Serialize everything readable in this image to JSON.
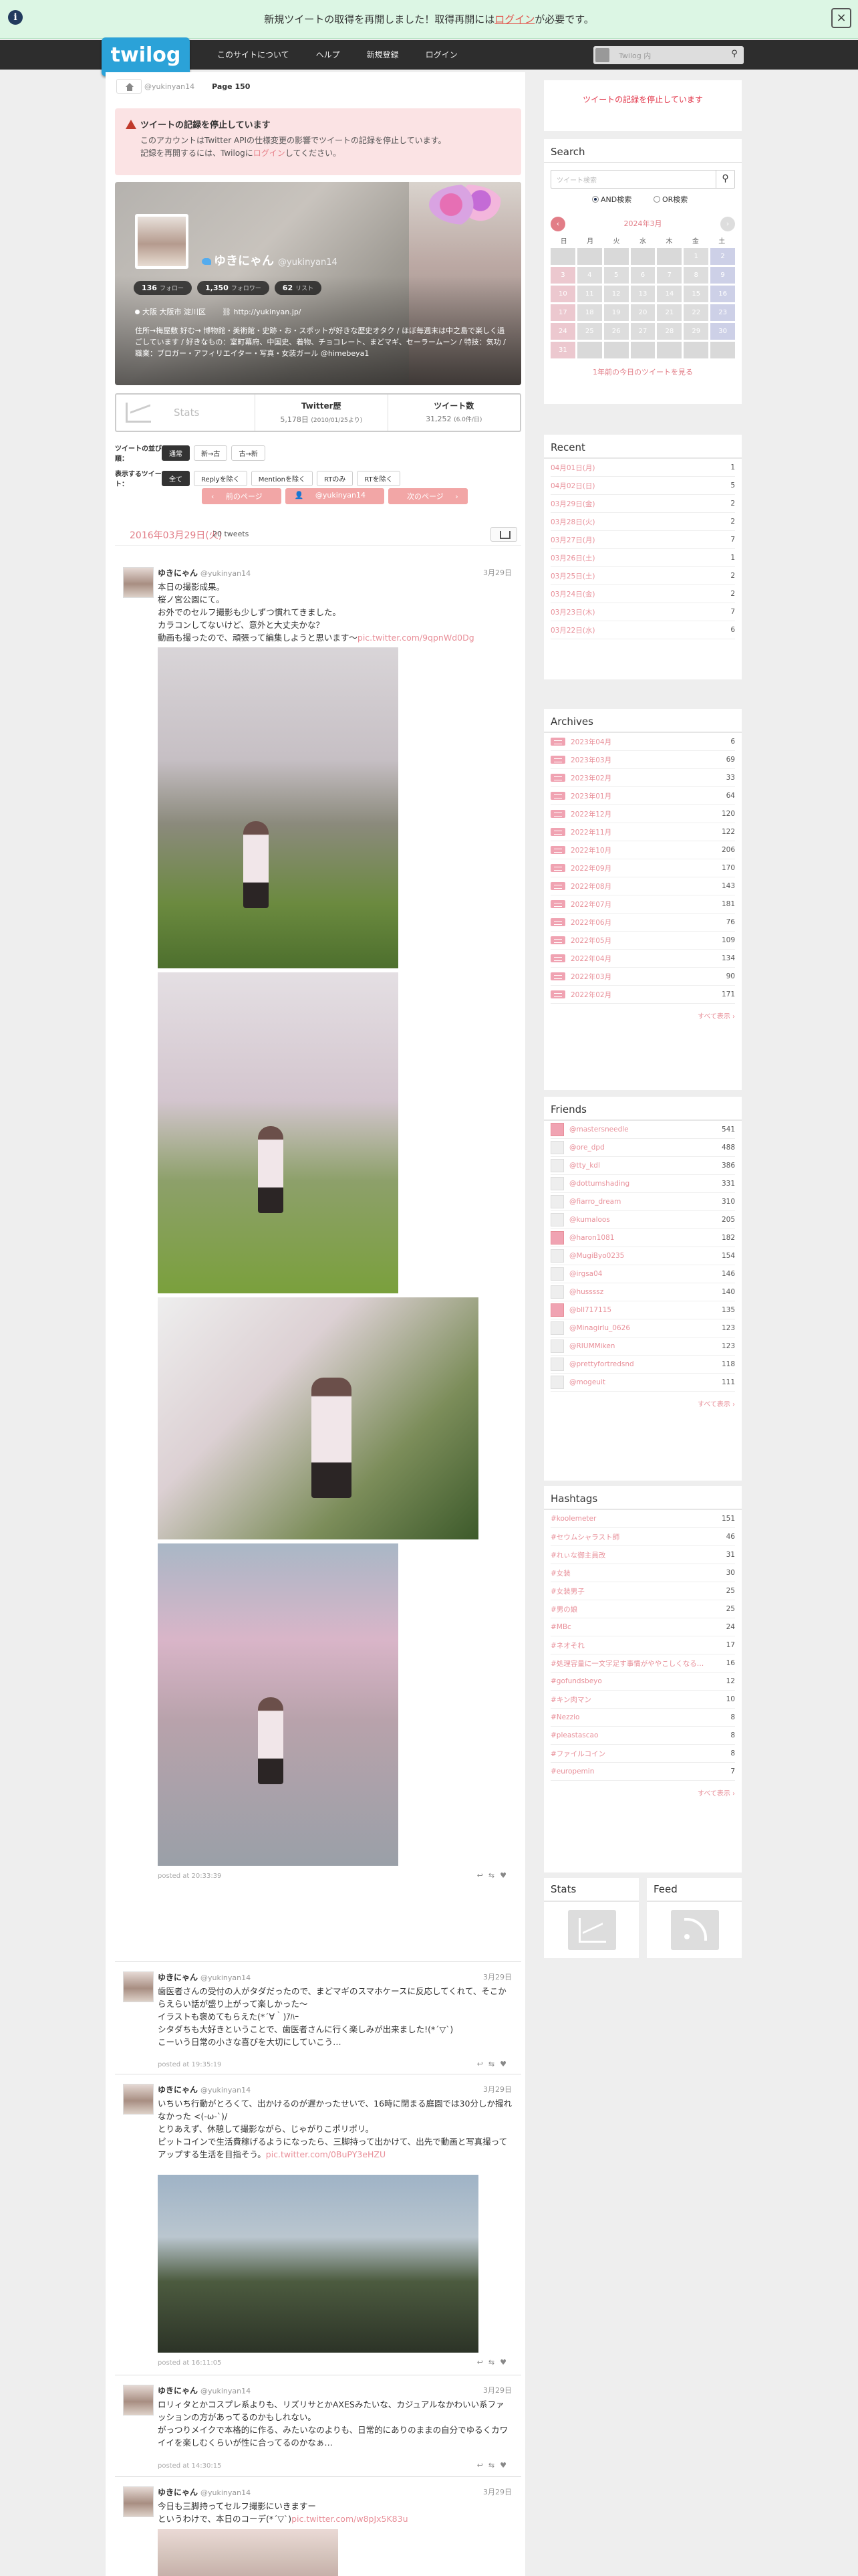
{
  "notice": {
    "text_before": "新規ツイートの取得を再開しました！取得再開には",
    "link": "ログイン",
    "text_after": "が必要です。",
    "info": "i",
    "close": "×"
  },
  "header": {
    "logo": "twilog",
    "nav": [
      "このサイトについて",
      "ヘルプ",
      "新規登録",
      "ログイン"
    ],
    "search_placeholder": "Twilog 内"
  },
  "breadcrumb": {
    "user": "@yukinyan14",
    "page": "Page 150"
  },
  "alert": {
    "title": "ツイートの記録を停止しています",
    "line1": "このアカウントはTwitter APIの仕様変更の影響でツイートの記録を停止しています。",
    "line2_before": "記録を再開するには、Twilogに",
    "line2_link": "ログイン",
    "line2_after": "してください。"
  },
  "profile": {
    "name": "ゆきにゃん",
    "handle": "@yukinyan14",
    "stats": [
      {
        "n": "136",
        "l": "フォロー"
      },
      {
        "n": "1,350",
        "l": "フォロワー"
      },
      {
        "n": "62",
        "l": "リスト"
      }
    ],
    "location": "大阪 大阪市 淀川区",
    "url": "http://yukinyan.jp/",
    "bio": "住所→梅屋敷 好む→ 博物館・美術館・史跡・お・スポットが好きな歴史オタク / ほぼ毎週末は中之島で楽しく過ごしています / 好きなもの：室町幕府、中国史、着物、チョコレート、まどマギ、セーラームーン / 特技：気功 / 職業：ブロガー・アフィリエイター・写真・女装ガール @himebeya1"
  },
  "statbox": {
    "stats_label": "Stats",
    "period_title": "Twitter歴",
    "period": "5,178日",
    "period_sub": "(2010/01/25より)",
    "tweets_title": "ツイート数",
    "tweets": "31,252",
    "tweets_sub": "(6.0件/日)"
  },
  "options": {
    "order_label": "ツイートの並び順：",
    "order": [
      "通常",
      "新→古",
      "古→新"
    ],
    "show_label": "表示するツイート：",
    "show": [
      "全て",
      "Replyを除く",
      "Mentionを除く",
      "RTのみ",
      "RTを除く"
    ]
  },
  "pager": {
    "prev": "前のページ",
    "user": "@yukinyan14",
    "next": "次のページ"
  },
  "day": {
    "date": "2016年03月29日(火)",
    "count": "20 tweets"
  },
  "tweets": [
    {
      "name": "ゆきにゃん",
      "handle": "@yukinyan14",
      "date": "3月29日",
      "lines": [
        "本日の撮影成果。",
        "桜ノ宮公園にて。",
        "お外でのセルフ撮影も少しずつ慣れてきました。",
        "カラコンしてないけど、意外と大丈夫かな？",
        "動画も撮ったので、頑張って編集しようと思います〜"
      ],
      "link": "pic.twitter.com/9qpnWd0Dg",
      "time": "posted at 20:33:39"
    },
    {
      "name": "ゆきにゃん",
      "handle": "@yukinyan14",
      "date": "3月29日",
      "lines": [
        "歯医者さんの受付の人がタダだったので、まどマギのスマホケースに反応してくれて、そこからえらい話が盛り上がって楽しかった〜",
        "イラストも褒めてもらえた(*´∀｀)ｱﾊｰ",
        "シタダちも大好きということで、歯医者さんに行く楽しみが出来ました!(*´▽`)",
        "こーいう日常の小さな喜びを大切にしていこう…"
      ],
      "link": "",
      "time": "posted at 19:35:19"
    },
    {
      "name": "ゆきにゃん",
      "handle": "@yukinyan14",
      "date": "3月29日",
      "lines": [
        "いちいち行動がとろくて、出かけるのが遅かったせいで、16時に閉まる庭園では30分しか撮れなかった <(-ω-`)/",
        "とりあえず、休憩して撮影ながら、じゃがりこポリポリ。",
        "ピットコインで生活費稼げるようになったら、三脚持って出かけて、出先で動画と写真撮ってアップする生活を目指そう。"
      ],
      "link": "pic.twitter.com/0BuPY3eHZU",
      "time": "posted at 16:11:05"
    },
    {
      "name": "ゆきにゃん",
      "handle": "@yukinyan14",
      "date": "3月29日",
      "lines": [
        "ロリィタとかコスプレ系よりも、リズリサとかAXESみたいな、カジュアルなかわいい系ファッションの方があってるのかもしれない。",
        "がっつりメイクで本格的に作る、みたいなのよりも、日常的にありのままの自分でゆるくカワイイを楽しむくらいが性に合ってるのかなぁ…"
      ],
      "link": "",
      "time": "posted at 14:30:15"
    },
    {
      "name": "ゆきにゃん",
      "handle": "@yukinyan14",
      "date": "3月29日",
      "lines": [
        "今日も三脚持ってセルフ撮影にいきますー",
        "というわけで、本日のコーデ(*´▽`)"
      ],
      "link": "pic.twitter.com/w8pJx5K83u",
      "time": ""
    }
  ],
  "sidebar": {
    "stopped": "ツイートの記録を停止しています",
    "search": {
      "title": "Search",
      "placeholder": "ツイート検索",
      "and": "AND検索",
      "or": "OR検索"
    },
    "calendar": {
      "month": "2024年3月",
      "prev": "‹",
      "next": "›",
      "weekdays": [
        "日",
        "月",
        "火",
        "水",
        "木",
        "金",
        "土"
      ],
      "days": [
        "",
        "",
        "",
        "",
        "",
        "1",
        "2",
        "3",
        "4",
        "5",
        "6",
        "7",
        "8",
        "9",
        "10",
        "11",
        "12",
        "13",
        "14",
        "15",
        "16",
        "17",
        "18",
        "19",
        "20",
        "21",
        "22",
        "23",
        "24",
        "25",
        "26",
        "27",
        "28",
        "29",
        "30",
        "31",
        "",
        "",
        "",
        "",
        "",
        ""
      ],
      "more": "1年前の今日のツイートを見る"
    },
    "recent": {
      "title": "Recent",
      "items": [
        [
          "04月01日(月)",
          "1"
        ],
        [
          "04月02日(日)",
          "5"
        ],
        [
          "03月29日(金)",
          "2"
        ],
        [
          "03月28日(火)",
          "2"
        ],
        [
          "03月27日(月)",
          "7"
        ],
        [
          "03月26日(土)",
          "1"
        ],
        [
          "03月25日(土)",
          "2"
        ],
        [
          "03月24日(金)",
          "2"
        ],
        [
          "03月23日(木)",
          "7"
        ],
        [
          "03月22日(水)",
          "6"
        ]
      ]
    },
    "archives": {
      "title": "Archives",
      "items": [
        [
          "2023年04月",
          "6"
        ],
        [
          "2023年03月",
          "69"
        ],
        [
          "2023年02月",
          "33"
        ],
        [
          "2023年01月",
          "64"
        ],
        [
          "2022年12月",
          "120"
        ],
        [
          "2022年11月",
          "122"
        ],
        [
          "2022年10月",
          "206"
        ],
        [
          "2022年09月",
          "170"
        ],
        [
          "2022年08月",
          "143"
        ],
        [
          "2022年07月",
          "181"
        ],
        [
          "2022年06月",
          "76"
        ],
        [
          "2022年05月",
          "109"
        ],
        [
          "2022年04月",
          "134"
        ],
        [
          "2022年03月",
          "90"
        ],
        [
          "2022年02月",
          "171"
        ]
      ],
      "more": "すべて表示 ›"
    },
    "friends": {
      "title": "Friends",
      "items": [
        [
          "@mastersneedle",
          "541"
        ],
        [
          "@ore_dpd",
          "488"
        ],
        [
          "@tty_kdl",
          "386"
        ],
        [
          "@dottumshading",
          "331"
        ],
        [
          "@fiarro_dream",
          "310"
        ],
        [
          "@kumaloos",
          "205"
        ],
        [
          "@haron1081",
          "182"
        ],
        [
          "@MugiByo0235",
          "154"
        ],
        [
          "@irgsa04",
          "146"
        ],
        [
          "@hussssz",
          "140"
        ],
        [
          "@bll717115",
          "135"
        ],
        [
          "@Minagirlu_0626",
          "123"
        ],
        [
          "@RIUMMiken",
          "123"
        ],
        [
          "@prettyfortredsnd",
          "118"
        ],
        [
          "@mogeuit",
          "111"
        ]
      ],
      "more": "すべて表示 ›"
    },
    "hashtags": {
      "title": "Hashtags",
      "items": [
        [
          "#koolemeter",
          "151"
        ],
        [
          "#セウムシャラスト師",
          "46"
        ],
        [
          "#れぃな御主員改",
          "31"
        ],
        [
          "#女装",
          "30"
        ],
        [
          "#女装男子",
          "25"
        ],
        [
          "#男の娘",
          "25"
        ],
        [
          "#MBc",
          "24"
        ],
        [
          "#ネオそれ",
          "17"
        ],
        [
          "#処理容量に一文字足す事情がややこしくなる…",
          "16"
        ],
        [
          "#gofundsbeyo",
          "12"
        ],
        [
          "#キン肉マン",
          "10"
        ],
        [
          "#Nezzio",
          "8"
        ],
        [
          "#pleastascao",
          "8"
        ],
        [
          "#ファイルコイン",
          "8"
        ],
        [
          "#europemin",
          "7"
        ]
      ],
      "more": "すべて表示 ›"
    },
    "stats": "Stats",
    "feed": "Feed"
  }
}
